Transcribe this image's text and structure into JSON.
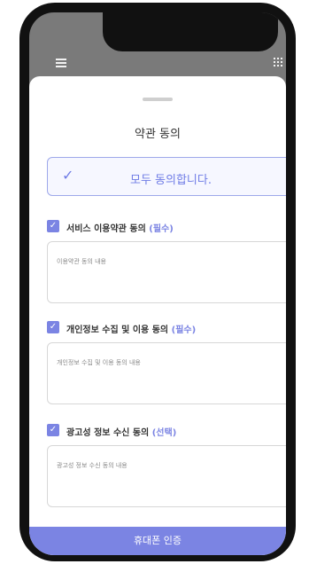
{
  "sheet": {
    "title": "약관 동의",
    "all_agree": "모두 동의합니다.",
    "consents": [
      {
        "title": "서비스 이용약관 동의",
        "tag": "(필수)",
        "content": "이용약관 동의 내용"
      },
      {
        "title": "개인정보 수집 및 이용 동의",
        "tag": "(필수)",
        "content": "개인정보 수집 및 이용 동의 내용"
      },
      {
        "title": "광고성 정보 수신 동의",
        "tag": "(선택)",
        "content": "광고성 정보 수신 동의 내용"
      }
    ],
    "cta": "휴대폰 인증"
  },
  "icons": [
    "menu-icon",
    "grid-icon",
    "check-icon"
  ],
  "colors": {
    "accent": "#7b84e3",
    "phone_frame": "#111111",
    "screen_bg": "#7a7a7a"
  }
}
